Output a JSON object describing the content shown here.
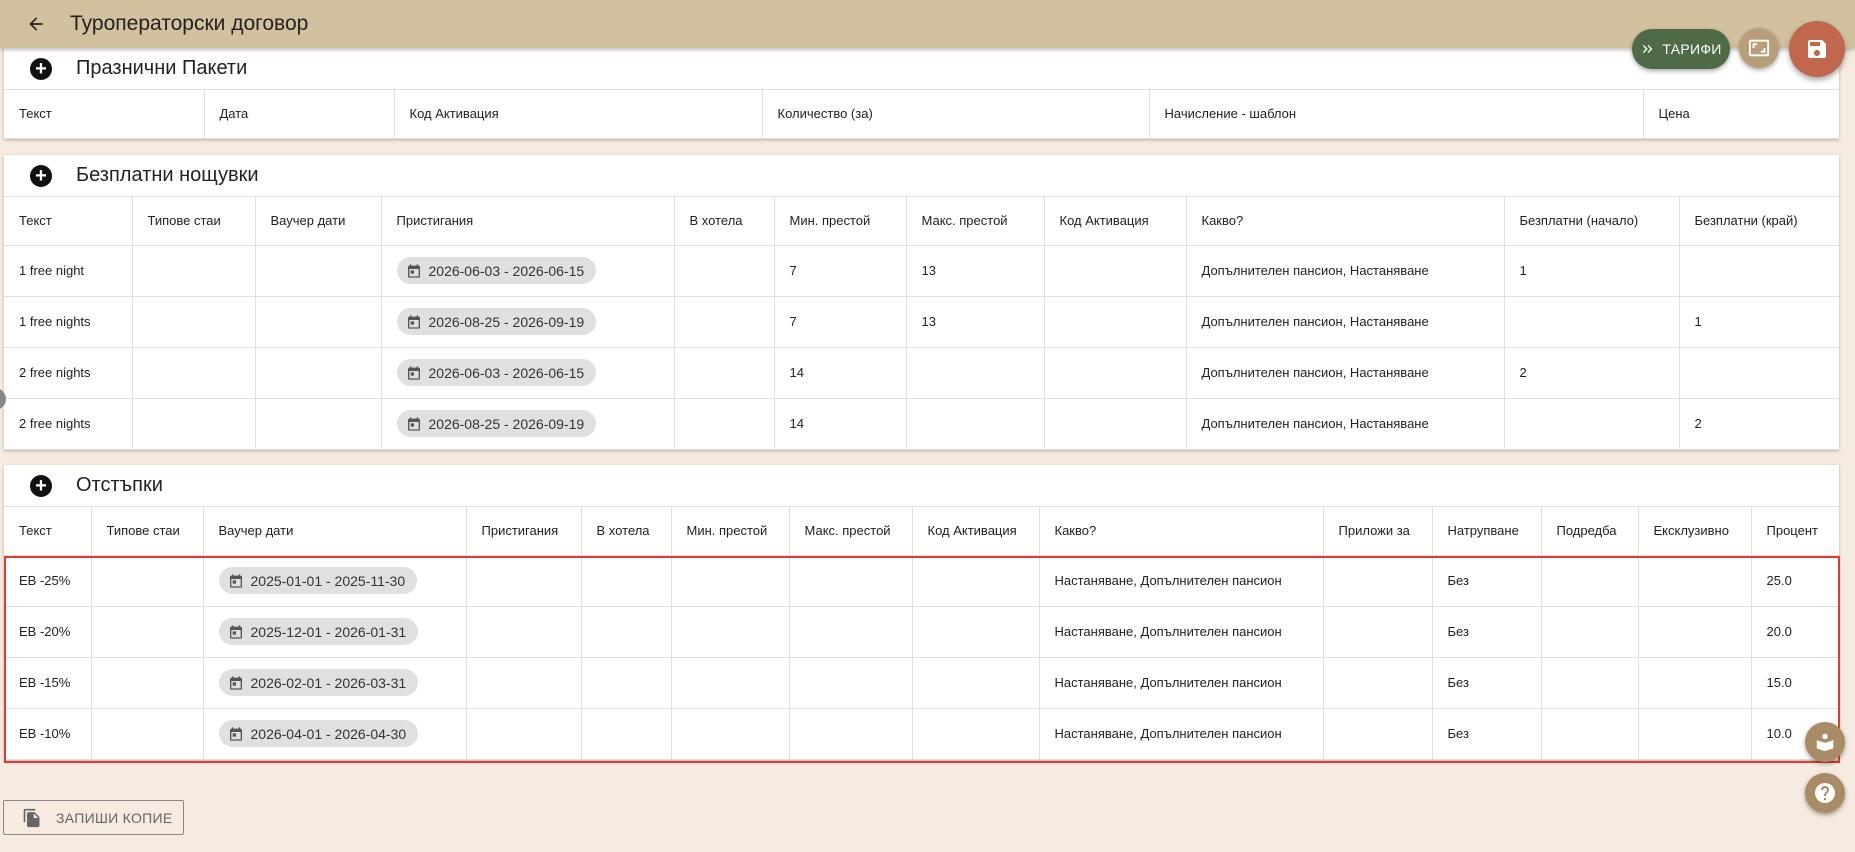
{
  "header": {
    "title": "Туроператорски договор"
  },
  "actions": {
    "tariffs_label": "ТАРИФИ"
  },
  "holiday": {
    "title": "Празнични Пакети",
    "columns": [
      "Текст",
      "Дата",
      "Код Активация",
      "Количество (за)",
      "Начисление - шаблон",
      "Цена"
    ]
  },
  "free": {
    "title": "Безплатни нощувки",
    "columns": [
      "Текст",
      "Типове стаи",
      "Ваучер дати",
      "Пристигания",
      "В хотела",
      "Мин. престой",
      "Макс. престой",
      "Код Активация",
      "Какво?",
      "Безплатни (начало)",
      "Безплатни (край)"
    ],
    "rows": [
      [
        "1 free night",
        "",
        "",
        "2026-06-03 - 2026-06-15",
        "",
        "7",
        "13",
        "",
        "Допълнителен пансион, Настаняване",
        "1",
        ""
      ],
      [
        "1 free nights",
        "",
        "",
        "2026-08-25 - 2026-09-19",
        "",
        "7",
        "13",
        "",
        "Допълнителен пансион, Настаняване",
        "",
        "1"
      ],
      [
        "2 free nights",
        "",
        "",
        "2026-06-03 - 2026-06-15",
        "",
        "14",
        "",
        "",
        "Допълнителен пансион, Настаняване",
        "2",
        ""
      ],
      [
        "2 free nights",
        "",
        "",
        "2026-08-25 - 2026-09-19",
        "",
        "14",
        "",
        "",
        "Допълнителен пансион, Настаняване",
        "",
        "2"
      ]
    ]
  },
  "discounts": {
    "title": "Отстъпки",
    "columns": [
      "Текст",
      "Типове стаи",
      "Ваучер дати",
      "Пристигания",
      "В хотела",
      "Мин. престой",
      "Макс. престой",
      "Код Активация",
      "Какво?",
      "Приложи за",
      "Натрупване",
      "Подредба",
      "Ексклузивно",
      "Процент"
    ],
    "rows": [
      [
        "EB -25%",
        "",
        "2025-01-01 - 2025-11-30",
        "",
        "",
        "",
        "",
        "",
        "Настаняване, Допълнителен пансион",
        "",
        "Без",
        "",
        "",
        "25.0"
      ],
      [
        "EB -20%",
        "",
        "2025-12-01 - 2026-01-31",
        "",
        "",
        "",
        "",
        "",
        "Настаняване, Допълнителен пансион",
        "",
        "Без",
        "",
        "",
        "20.0"
      ],
      [
        "EB -15%",
        "",
        "2026-02-01 - 2026-03-31",
        "",
        "",
        "",
        "",
        "",
        "Настаняване, Допълнителен пансион",
        "",
        "Без",
        "",
        "",
        "15.0"
      ],
      [
        "EB -10%",
        "",
        "2026-04-01 - 2026-04-30",
        "",
        "",
        "",
        "",
        "",
        "Настаняване, Допълнителен пансион",
        "",
        "Без",
        "",
        "",
        "10.0"
      ]
    ]
  },
  "footer": {
    "copy_label": "ЗАПИШИ КОПИЕ"
  },
  "colors": {
    "header_bg": "#d1c19e",
    "page_bg": "#f5ebe0",
    "tariffs_bg": "#4f6a47",
    "save_bg": "#c0674e",
    "highlight": "#e53935"
  }
}
